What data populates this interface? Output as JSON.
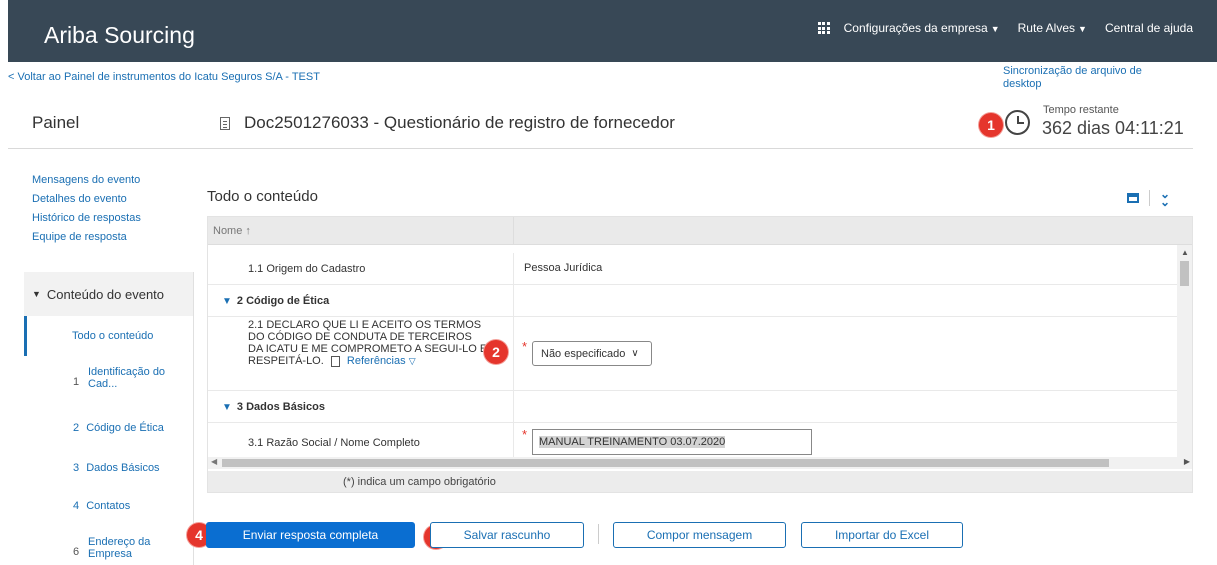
{
  "app": {
    "brand": "Ariba Sourcing"
  },
  "topnav": {
    "company_settings": "Configurações da empresa",
    "user": "Rute Alves",
    "help": "Central de ajuda"
  },
  "back_link": "< Voltar ao Painel de instrumentos do Icatu Seguros S/A - TEST",
  "sync_link": "Sincronização de arquivo de desktop",
  "header": {
    "painel": "Painel",
    "doc_title": "Doc2501276033 - Questionário de registro de fornecedor",
    "time_label": "Tempo restante",
    "time_value": "362 dias 04:11:21"
  },
  "sidebar": {
    "links": [
      "Mensagens do evento",
      "Detalhes do evento",
      "Histórico de respostas",
      "Equipe de resposta"
    ],
    "section_title": "Conteúdo do evento",
    "items": [
      {
        "num": "",
        "label": "Todo o conteúdo"
      },
      {
        "num": "1",
        "label": "Identificação do Cad..."
      },
      {
        "num": "2",
        "label": "Código de Ética"
      },
      {
        "num": "3",
        "label": "Dados Básicos"
      },
      {
        "num": "4",
        "label": "Contatos"
      },
      {
        "num": "6",
        "label": "Endereço da Empresa"
      }
    ]
  },
  "content": {
    "title": "Todo o conteúdo",
    "col_name": "Nome ↑",
    "rows": {
      "r11": {
        "label": "1.1  Origem do Cadastro",
        "value": "Pessoa Jurídica"
      },
      "s2": {
        "label": "2  Código de Ética"
      },
      "r21": {
        "label": "2.1  DECLARO QUE LI E ACEITO OS TERMOS DO CÓDIGO DE CONDUTA DE TERCEIROS DA ICATU E ME COMPROMETO A SEGUI-LO E RESPEITÁ-LO.",
        "refs": "Referências",
        "value": "Não especificado"
      },
      "s3": {
        "label": "3  Dados Básicos"
      },
      "r31": {
        "label": "3.1  Razão Social / Nome Completo",
        "value": "MANUAL TREINAMENTO 03.07.2020"
      }
    },
    "required_note": "(*) indica um campo obrigatório",
    "required_mark": "*"
  },
  "buttons": {
    "submit": "Enviar resposta completa",
    "save": "Salvar rascunho",
    "compose": "Compor mensagem",
    "import": "Importar do Excel"
  },
  "badges": [
    "1",
    "2",
    "3",
    "4"
  ],
  "colors": {
    "topbar": "#384856",
    "link": "#1a6fb3",
    "primary": "#0a6ed1",
    "badge": "#e5352c"
  }
}
